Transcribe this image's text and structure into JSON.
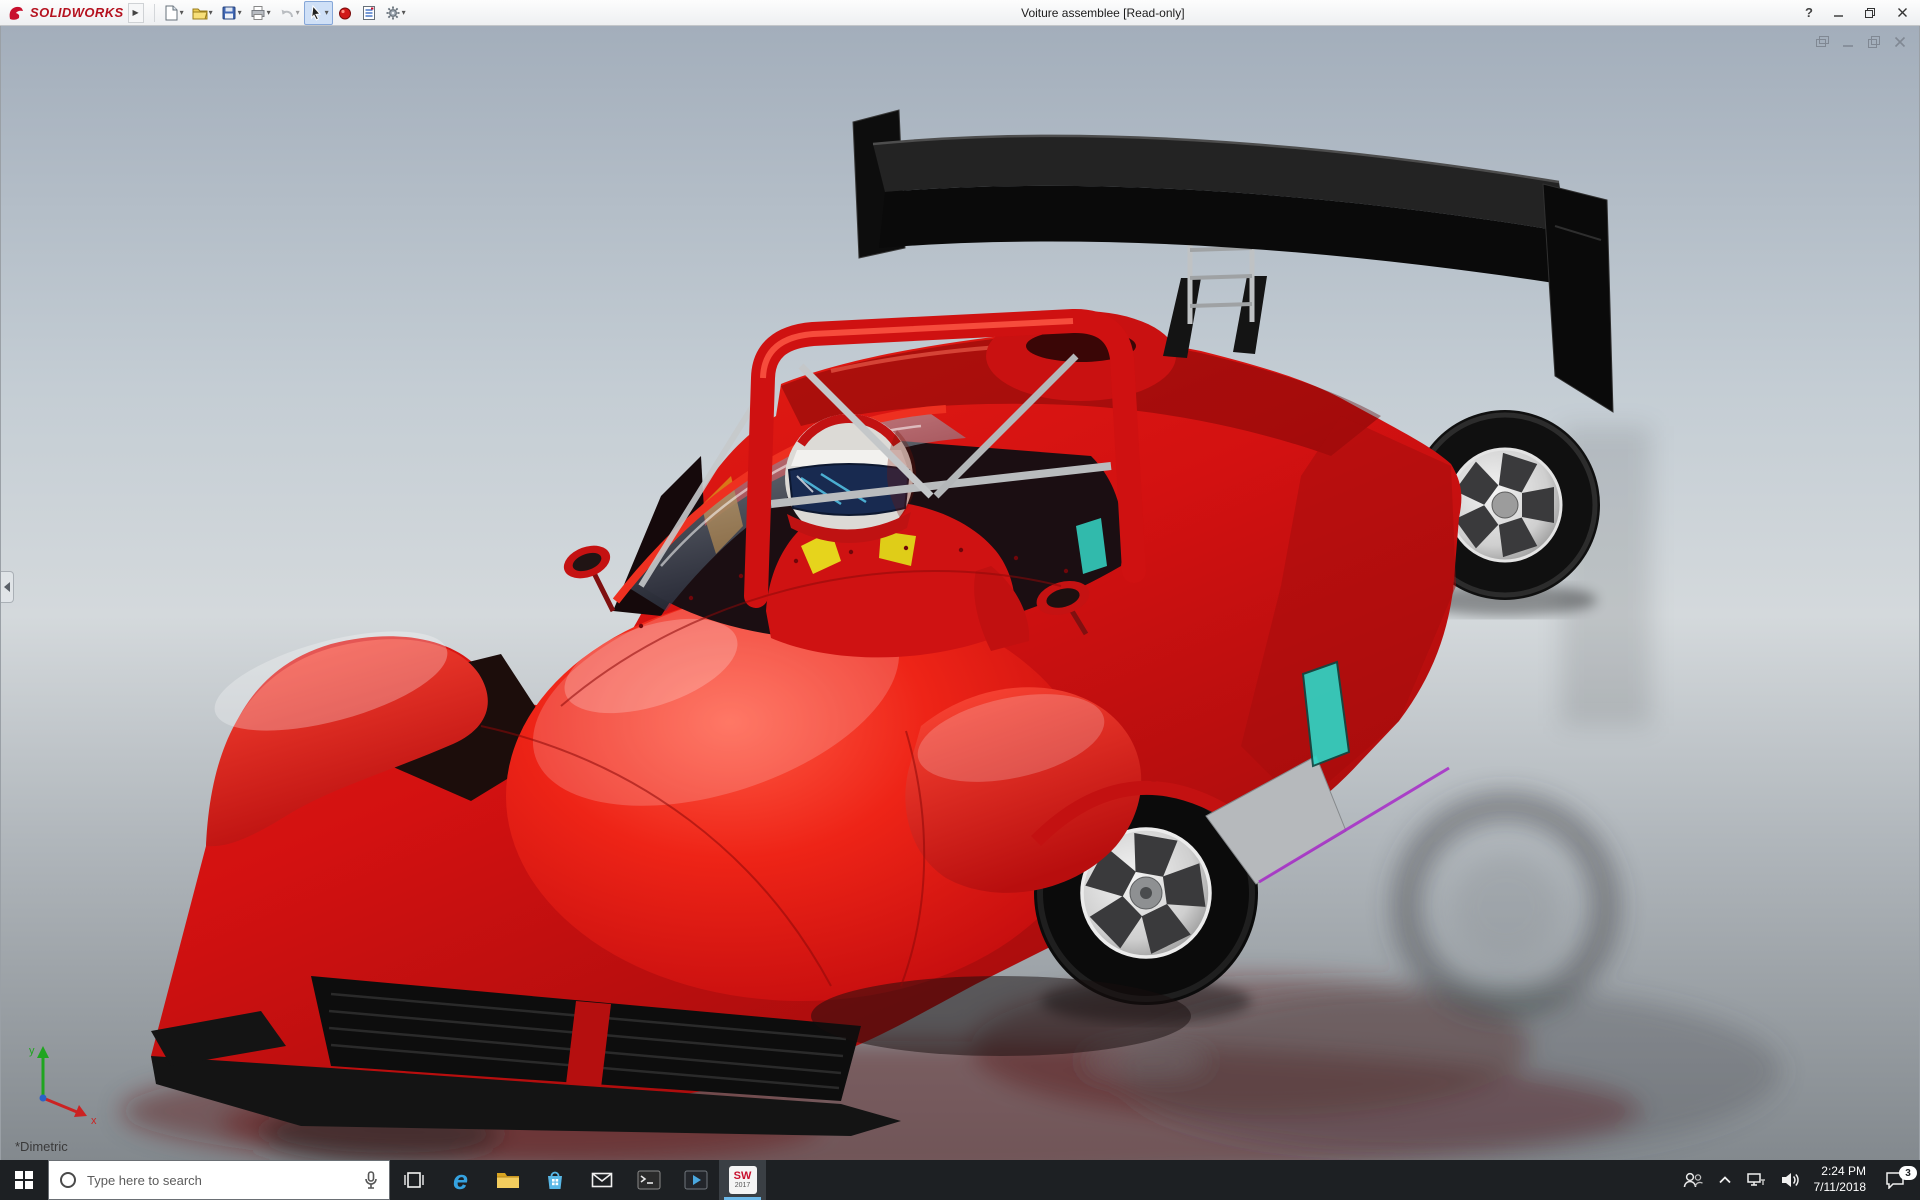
{
  "titlebar": {
    "brand": "SOLIDWORKS",
    "title": "Voiture assemblee [Read-only]",
    "help_label": "?",
    "tools": [
      "new-document",
      "open",
      "save",
      "print",
      "undo",
      "select",
      "appearance",
      "mass-properties",
      "options"
    ]
  },
  "document_window": {
    "controls": [
      "cascade",
      "minimize",
      "restore",
      "close"
    ]
  },
  "viewport": {
    "view_label": "*Dimetric",
    "triad": {
      "x_label": "x",
      "y_label": "y"
    }
  },
  "model": {
    "name": "Voiture assemblee",
    "type": "assembly",
    "parts": [
      "body",
      "rear-wing",
      "roll-hoop",
      "driver",
      "helmet",
      "windscreen",
      "front-right-wheel",
      "rear-right-wheel",
      "mirrors",
      "front-splitter",
      "grille",
      "side-window"
    ],
    "colors": {
      "body": "#d41212",
      "wing": "#141414",
      "rims": "#cccccc",
      "interior_accent": "#35d8c8",
      "skirt_accent": "#a832c8",
      "helmet": "#e8e6e2",
      "background_top": "#a6b1bd",
      "background_floor": "#878d92"
    }
  },
  "taskbar": {
    "search": {
      "placeholder": "Type here to search"
    },
    "apps": [
      {
        "name": "task-view"
      },
      {
        "name": "edge",
        "glyph": "e"
      },
      {
        "name": "file-explorer"
      },
      {
        "name": "store"
      },
      {
        "name": "mail"
      },
      {
        "name": "command-prompt"
      },
      {
        "name": "media-player"
      },
      {
        "name": "solidworks-2017",
        "label": "SW",
        "year": "2017"
      }
    ],
    "tray": {
      "time": "2:24 PM",
      "date": "7/11/2018",
      "notification_count": "3"
    }
  }
}
